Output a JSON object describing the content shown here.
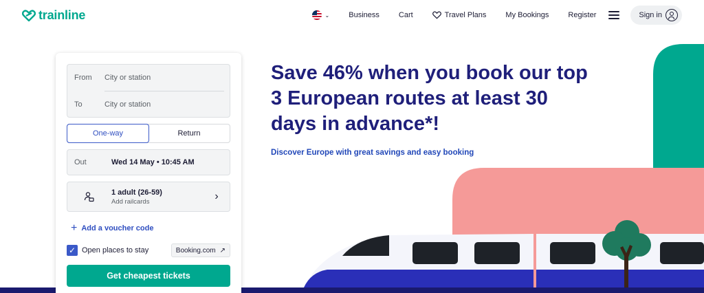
{
  "header": {
    "logo_text": "trainline",
    "nav": {
      "business": "Business",
      "cart": "Cart",
      "travel_plans": "Travel Plans",
      "my_bookings": "My Bookings",
      "register": "Register",
      "sign_in": "Sign in"
    }
  },
  "search": {
    "from_label": "From",
    "from_placeholder": "City or station",
    "to_label": "To",
    "to_placeholder": "City or station",
    "trip_types": [
      "One-way",
      "Return"
    ],
    "selected_trip_type": "One-way",
    "out_label": "Out",
    "out_value": "Wed 14 May • 10:45 AM",
    "passengers_main": "1 adult (26-59)",
    "passengers_sub": "Add railcards",
    "voucher_label": "Add a voucher code",
    "stay_label": "Open places to stay",
    "stay_checked": true,
    "partner_label": "Booking.com",
    "cta_label": "Get cheapest tickets"
  },
  "hero": {
    "headline": "Save 46% when you book our top 3 European routes at least 30 days in advance*!",
    "subhead": "Discover Europe with great savings and easy booking"
  },
  "colors": {
    "brand": "#00a88f",
    "headline": "#1f1f7a",
    "link": "#2f4ec0",
    "train_blue": "#2a2fb8",
    "pink": "#f59a98"
  }
}
